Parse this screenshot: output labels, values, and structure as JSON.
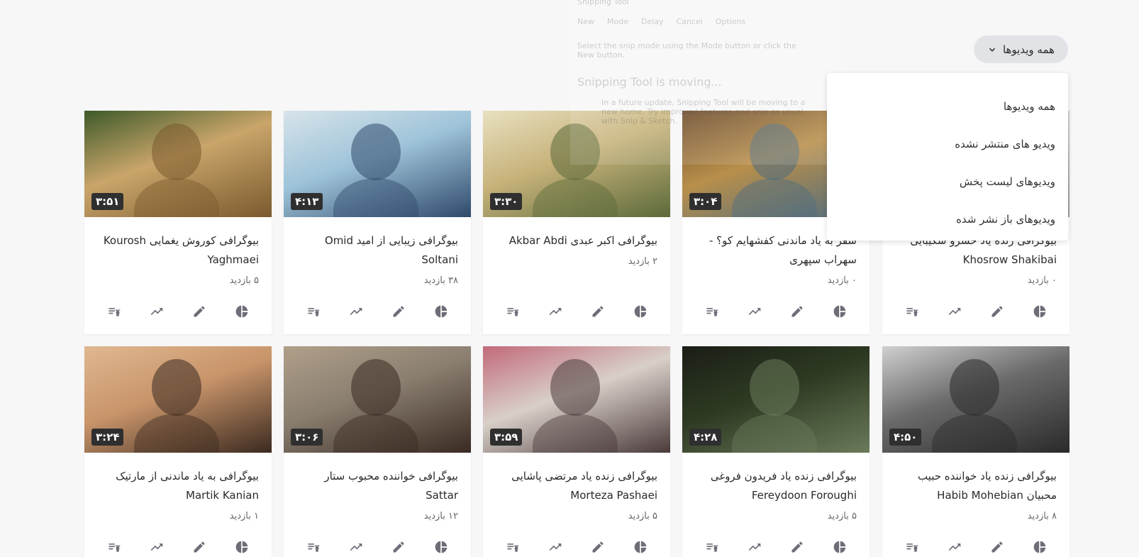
{
  "filter": {
    "label": "همه ویدیوها"
  },
  "dropdown": {
    "options": [
      "همه ویدیوها",
      "ویدیو های منتشر نشده",
      "ویدیوهای لیست پخش",
      "ویدیوهای باز نشر شده"
    ]
  },
  "snipping_tool": {
    "window_title": "Snipping Tool",
    "new": "New",
    "mode": "Mode",
    "delay": "Delay",
    "cancel": "Cancel",
    "options": "Options",
    "hint": "Select the snip mode using the Mode button or click the New button.",
    "moving_title": "Snipping Tool is moving...",
    "moving_body": "In a future update, Snipping Tool will be moving to a new home. Try improved features and snip as usual with Snip & Sketch."
  },
  "videos": [
    {
      "title": "بیوگرافی کوروش یغمایی Kourosh Yaghmaei",
      "views": "۵ بازدید",
      "duration": "۳:۵۱",
      "colors": [
        "#c9a56a",
        "#7a5a2e",
        "#3e5a2a"
      ]
    },
    {
      "title": "بیوگرافی زیبایی از امید Omid Soltani",
      "views": "۳۸ بازدید",
      "duration": "۴:۱۳",
      "colors": [
        "#9ec3d9",
        "#2f4a6b",
        "#d7e4ea"
      ]
    },
    {
      "title": "بیوگرافی اکبر عبدی Akbar Abdi",
      "views": "۲ بازدید",
      "duration": "۳:۳۰",
      "colors": [
        "#c7b27a",
        "#5b6a3a",
        "#e8e0c0"
      ]
    },
    {
      "title": "سفر به یاد ماندنی کفشهایم کو؟ - سهراب سپهری",
      "views": "۰ بازدید",
      "duration": "۳:۰۴",
      "colors": [
        "#b88f4b",
        "#4e6c80",
        "#6b4a2a"
      ]
    },
    {
      "title": "بیوگرافی زنده یاد خسرو شکیبایی Khosrow Shakibai",
      "views": "۰ بازدید",
      "duration": "",
      "colors": [
        "#cccccc",
        "#999999",
        "#eeeeee"
      ]
    },
    {
      "title": "بیوگرافی به یاد ماندنی از مارتیک Martik Kanian",
      "views": "۱ بازدید",
      "duration": "۳:۲۴",
      "colors": [
        "#c8946a",
        "#3b2a20",
        "#e0b890"
      ]
    },
    {
      "title": "بیوگرافی خواننده محبوب ستار Sattar",
      "views": "۱۲ بازدید",
      "duration": "۳:۰۶",
      "colors": [
        "#8a7e70",
        "#3a2a22",
        "#b0a08a"
      ]
    },
    {
      "title": "بیوگرافی زنده یاد مرتضی پاشایی Morteza Pashaei",
      "views": "۵ بازدید",
      "duration": "۳:۵۹",
      "colors": [
        "#d8cfc8",
        "#4a3a3a",
        "#c26a7a"
      ]
    },
    {
      "title": "بیوگرافی زنده یاد فریدون فروغی Fereydoon Foroughi",
      "views": "۵ بازدید",
      "duration": "۴:۲۸",
      "colors": [
        "#2e3a22",
        "#6a7a5a",
        "#1a1e16"
      ]
    },
    {
      "title": "بیوگرافی زنده یاد خواننده حبیب محبیان Habib Mohebian",
      "views": "۸ بازدید",
      "duration": "۴:۵۰",
      "colors": [
        "#6a6a6a",
        "#2a2a2a",
        "#d0d0d0"
      ]
    }
  ],
  "icons": [
    "stats-icon",
    "edit-icon",
    "trending-icon",
    "playlist-remove-icon"
  ]
}
